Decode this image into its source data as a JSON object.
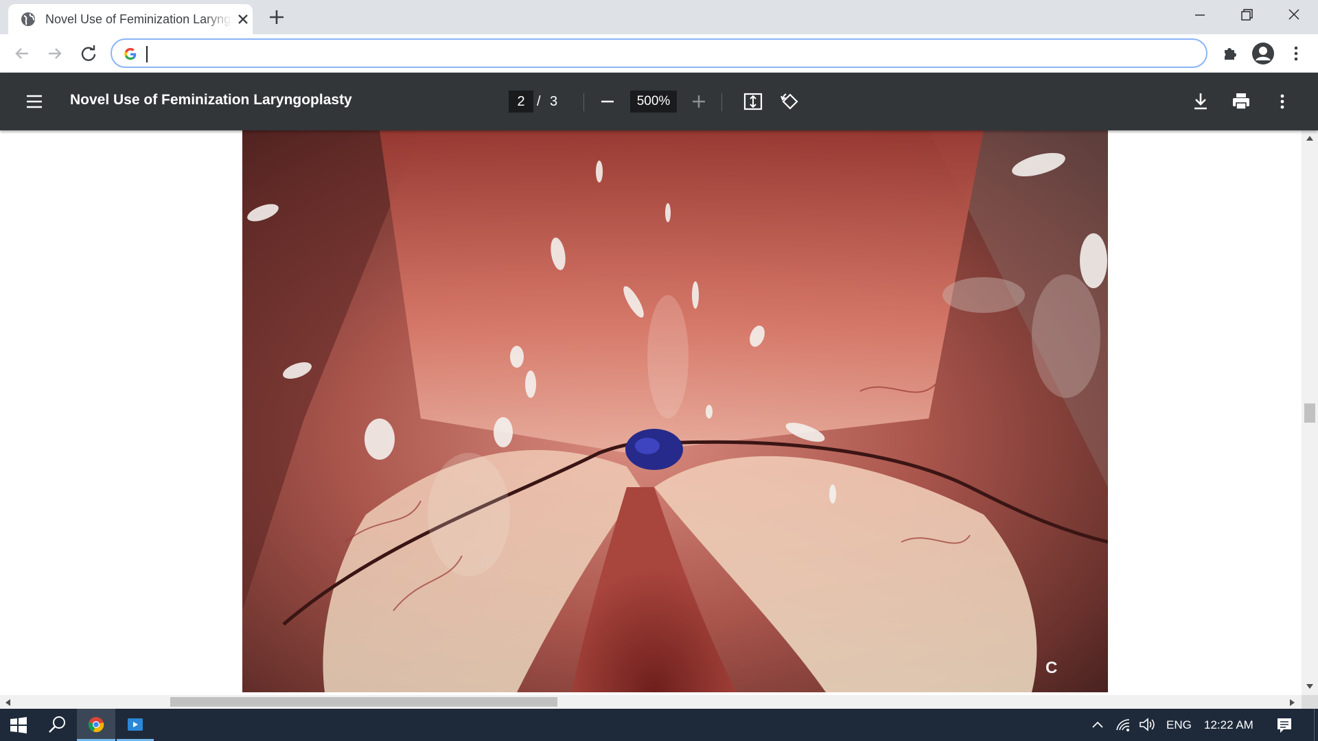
{
  "browser": {
    "tab": {
      "title": "Novel Use of Feminization Laryngoplasty",
      "favicon": "globe-icon"
    },
    "omnibox": {
      "value": "",
      "placeholder": ""
    }
  },
  "pdf_viewer": {
    "title": "Novel Use of Feminization Laryngoplasty",
    "page": {
      "current": "2",
      "separator": "/",
      "total": "3"
    },
    "zoom": "500%",
    "figure": {
      "label": "C"
    }
  },
  "taskbar": {
    "language": "ENG",
    "time": "12:22 AM"
  },
  "colors": {
    "tabstrip": "#dee1e6",
    "pdf_toolbar": "#323639",
    "omnibox_focus": "#8ab4f8",
    "taskbar": "#1e2a3a",
    "taskbar_active_underline": "#76b9ed"
  }
}
